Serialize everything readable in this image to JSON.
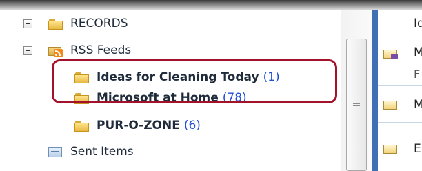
{
  "folders": [
    {
      "name": "RECORDS",
      "expander": "plus",
      "icon": "folder-icon"
    },
    {
      "name": "RSS Feeds",
      "expander": "minus",
      "icon": "rss-folder-icon"
    },
    {
      "name": "Ideas for Cleaning Today",
      "count": "(1)",
      "icon": "folder-icon"
    },
    {
      "name": "Microsoft at Home",
      "count": "(78)",
      "icon": "folder-icon"
    },
    {
      "name": "PUR-O-ZONE",
      "count": "(6)",
      "icon": "folder-icon"
    },
    {
      "name": "Sent Items",
      "icon": "sent-items-icon"
    }
  ],
  "messages": [
    {
      "line1": "Id"
    },
    {
      "line1": "M",
      "line2": "F"
    },
    {
      "line1": "M"
    },
    {
      "line1": "E"
    }
  ],
  "colors": {
    "highlight_border": "#a3122b",
    "count_link": "#1f4fd6",
    "pane_divider": "#3f6fb4"
  }
}
